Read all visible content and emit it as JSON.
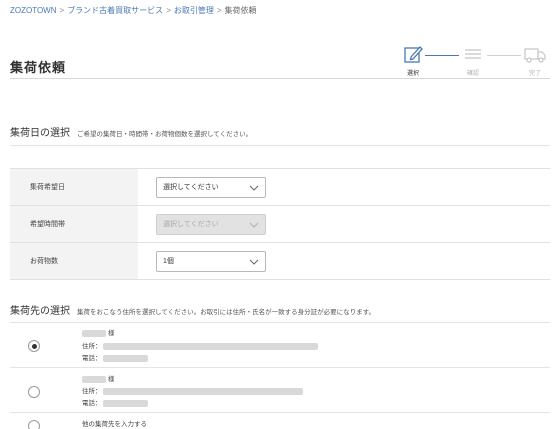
{
  "breadcrumb": {
    "items": [
      "ZOZOTOWN",
      "ブランド古着買取サービス",
      "お取引管理",
      "集荷依頼"
    ],
    "separator": ">"
  },
  "page": {
    "title": "集荷依頼"
  },
  "steps": [
    {
      "label": "選択",
      "icon": "pencil-icon",
      "state": "active"
    },
    {
      "label": "確認",
      "icon": "list-icon",
      "state": "inactive"
    },
    {
      "label": "完了",
      "icon": "truck-icon",
      "state": "inactive"
    }
  ],
  "pickup_date_section": {
    "heading": "集荷日の選択",
    "note": "ご希望の集荷日・時間帯・お荷物個数を選択してください。",
    "rows": [
      {
        "label": "集荷希望日",
        "value": "選択してください",
        "disabled": false
      },
      {
        "label": "希望時間帯",
        "value": "選択してください",
        "disabled": true
      },
      {
        "label": "お荷物数",
        "value": "1個",
        "disabled": false
      }
    ]
  },
  "pickup_address_section": {
    "heading": "集荷先の選択",
    "note": "集荷をおこなう住所を選択してください。お取引には住所・氏名が一致する身分証が必要になります。",
    "addresses": [
      {
        "honorific": "様",
        "address_label": "住所：",
        "phone_label": "電話：",
        "selected": true
      },
      {
        "honorific": "様",
        "address_label": "住所：",
        "phone_label": "電話：",
        "selected": false
      }
    ],
    "other_option": "他の集荷先を入力する"
  },
  "colors": {
    "accent": "#4a78b5",
    "label_bg": "#f3f3f3",
    "disabled_bg": "#e2e2e2"
  }
}
